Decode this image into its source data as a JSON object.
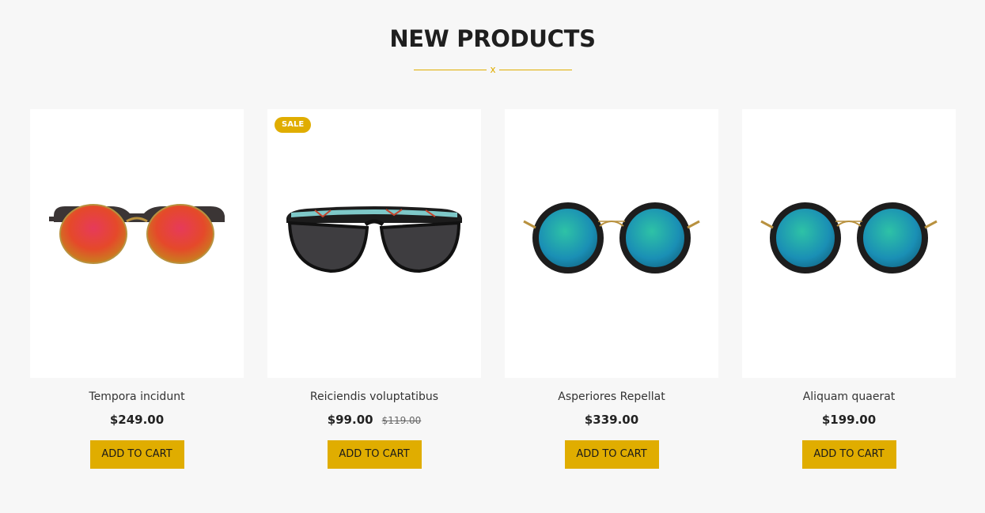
{
  "section": {
    "title": "NEW PRODUCTS",
    "divider_mark": "x"
  },
  "colors": {
    "accent": "#e0ad00",
    "background": "#f7f7f7"
  },
  "products": [
    {
      "name": "Tempora incidunt",
      "price": "$249.00",
      "old_price": "",
      "badge": "",
      "button": "ADD TO CART",
      "image": "sunglasses-red-lens-clubmaster"
    },
    {
      "name": "Reiciendis voluptatibus",
      "price": "$99.00",
      "old_price": "$119.00",
      "badge": "SALE",
      "button": "ADD TO CART",
      "image": "sunglasses-black-patterned-brow"
    },
    {
      "name": "Asperiores Repellat",
      "price": "$339.00",
      "old_price": "",
      "badge": "",
      "button": "ADD TO CART",
      "image": "sunglasses-round-teal-mirror"
    },
    {
      "name": "Aliquam quaerat",
      "price": "$199.00",
      "old_price": "",
      "badge": "",
      "button": "ADD TO CART",
      "image": "sunglasses-round-teal-mirror"
    }
  ]
}
